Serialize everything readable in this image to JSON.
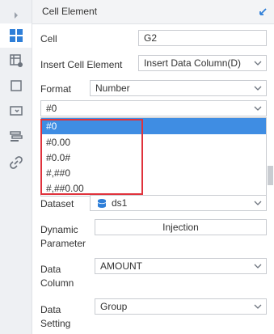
{
  "panel": {
    "title": "Cell Element"
  },
  "fields": {
    "cell_label": "Cell",
    "cell_value": "G2",
    "insert_label": "Insert Cell Element",
    "insert_value": "Insert Data Column(D)",
    "format_label": "Format",
    "format_value": "Number",
    "format_pattern_value": "#0",
    "dataset_label": "Dataset",
    "dataset_value": "ds1",
    "dynamic_label_line1": "Dynamic",
    "dynamic_label_line2": "Parameter",
    "injection_button": "Injection",
    "data_column_label_line1": "Data",
    "data_column_label_line2": "Column",
    "data_column_value": "AMOUNT",
    "data_setting_label_line1": "Data",
    "data_setting_label_line2": "Setting",
    "data_setting_value": "Group"
  },
  "dropdown": {
    "options": [
      "#0",
      "#0.00",
      "#0.0#",
      "#,##0",
      "#,##0.00"
    ],
    "selected_index": 0
  },
  "colors": {
    "accent": "#3f8de3",
    "highlight_box": "#e0323c",
    "sidebar_bg": "#eef0f3"
  }
}
